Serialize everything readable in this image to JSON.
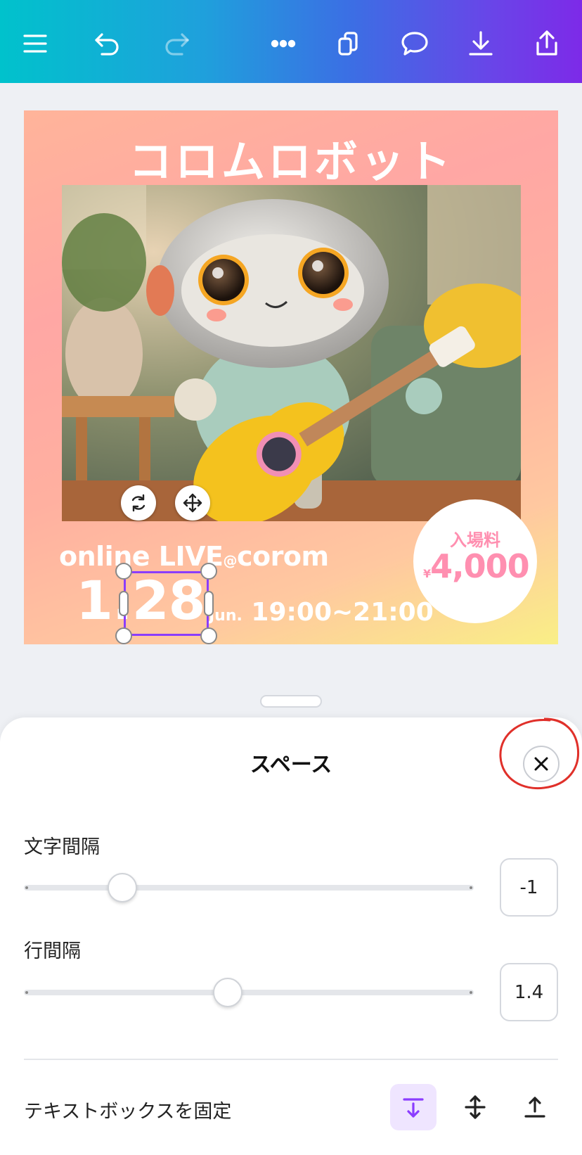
{
  "toolbar": {
    "icons": [
      "menu-icon",
      "undo-icon",
      "redo-icon",
      "more-icon",
      "copy-pages-icon",
      "comment-icon",
      "download-icon",
      "share-icon"
    ]
  },
  "design": {
    "title": "コロムロボット",
    "online_text": "online LIVE",
    "online_at": "@",
    "online_suffix": "corom",
    "date": "1.28",
    "month": "Jun.",
    "time": "19:00~21:00",
    "price_label": "入場料",
    "price_currency": "¥",
    "price_value": "4,000"
  },
  "sheet": {
    "title": "スペース",
    "letter_spacing": {
      "label": "文字間隔",
      "value": "-1",
      "position": 0.2
    },
    "line_spacing": {
      "label": "行間隔",
      "value": "1.4",
      "position": 0.43
    },
    "anchor": {
      "label": "テキストボックスを固定",
      "options": [
        "anchor-top-icon",
        "anchor-middle-icon",
        "anchor-bottom-icon"
      ],
      "selected": "anchor-top-icon"
    }
  },
  "colors": {
    "accent": "#8b3dff",
    "annotation": "#e0302a"
  }
}
